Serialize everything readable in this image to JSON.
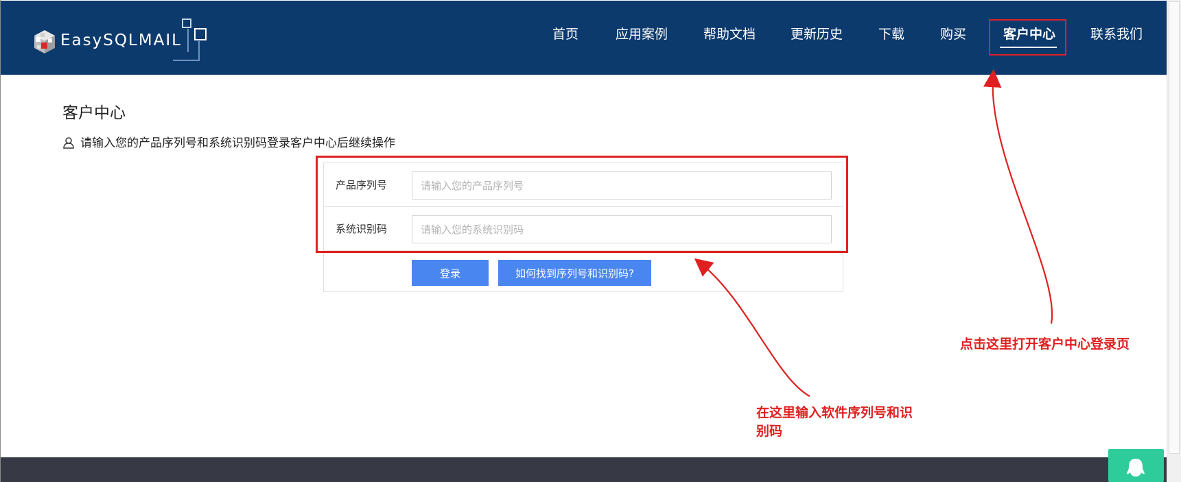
{
  "header": {
    "logo_text": "EasySQLMAIL",
    "nav": [
      {
        "label": "首页"
      },
      {
        "label": "应用案例"
      },
      {
        "label": "帮助文档"
      },
      {
        "label": "更新历史"
      },
      {
        "label": "下载"
      },
      {
        "label": "购买"
      },
      {
        "label": "客户中心",
        "active": true
      },
      {
        "label": "联系我们"
      }
    ]
  },
  "main": {
    "title": "客户中心",
    "hint": "请输入您的产品序列号和系统识别码登录客户中心后继续操作",
    "form": {
      "serial_label": "产品序列号",
      "serial_placeholder": "请输入您的产品序列号",
      "serial_value": "",
      "sysid_label": "系统识别码",
      "sysid_placeholder": "请输入您的系统识别码",
      "sysid_value": "",
      "login_button": "登录",
      "help_button": "如何找到序列号和识别码?"
    }
  },
  "annotations": {
    "nav_note": "点击这里打开客户中心登录页",
    "form_note": "在这里输入软件序列号和识别码"
  },
  "colors": {
    "header_bg": "#0d3a6d",
    "button_bg": "#4a86f0",
    "annotation_red": "#e02020",
    "footer_bg": "#373a44",
    "chat_widget": "#2ecc9a"
  },
  "icons": {
    "hint_icon": "user-icon",
    "chat_icon": "qq-penguin-icon"
  }
}
